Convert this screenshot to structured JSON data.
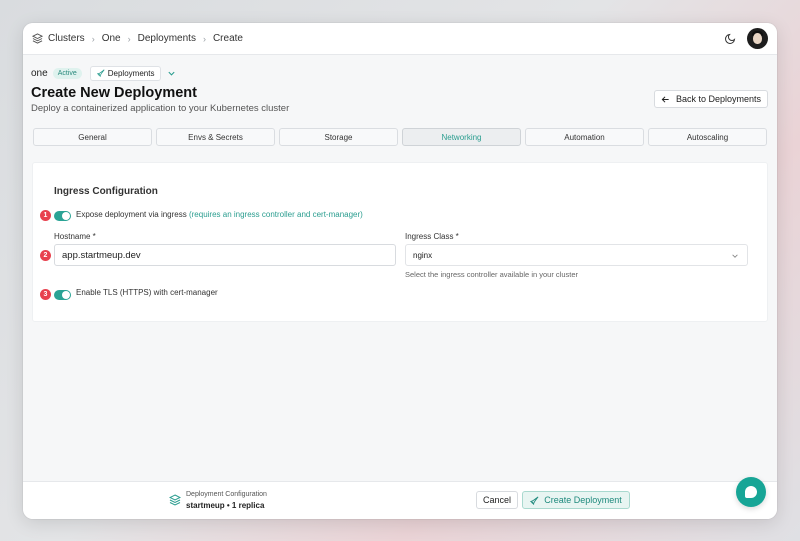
{
  "breadcrumb": [
    "Clusters",
    "One",
    "Deployments",
    "Create"
  ],
  "header": {
    "cluster_name": "one",
    "status": "Active",
    "section": "Deployments"
  },
  "page": {
    "title": "Create New Deployment",
    "subtitle": "Deploy a containerized application to your Kubernetes cluster",
    "back_label": "Back to Deployments"
  },
  "tabs": [
    {
      "label": "General",
      "active": false
    },
    {
      "label": "Envs & Secrets",
      "active": false
    },
    {
      "label": "Storage",
      "active": false
    },
    {
      "label": "Networking",
      "active": true
    },
    {
      "label": "Automation",
      "active": false
    },
    {
      "label": "Autoscaling",
      "active": false
    }
  ],
  "ingress": {
    "title": "Ingress Configuration",
    "expose_label": "Expose deployment via ingress",
    "expose_hint": "(requires an ingress controller and cert-manager)",
    "expose_enabled": true,
    "hostname_label": "Hostname *",
    "hostname_value": "app.startmeup.dev",
    "class_label": "Ingress Class *",
    "class_value": "nginx",
    "class_helper": "Select the ingress controller available in your cluster",
    "tls_label": "Enable TLS (HTTPS) with cert-manager",
    "tls_enabled": true
  },
  "markers": [
    "1",
    "2",
    "3"
  ],
  "footer": {
    "title": "Deployment Configuration",
    "summary": "startmeup • 1 replica",
    "cancel_label": "Cancel",
    "create_label": "Create Deployment"
  },
  "colors": {
    "accent": "#2aa395",
    "marker": "#e8414e"
  },
  "icons": [
    "layers-icon",
    "chevron-right-icon",
    "moon-icon",
    "avatar",
    "rocket-icon",
    "chevron-down-icon",
    "arrow-left-icon",
    "chat-icon"
  ]
}
